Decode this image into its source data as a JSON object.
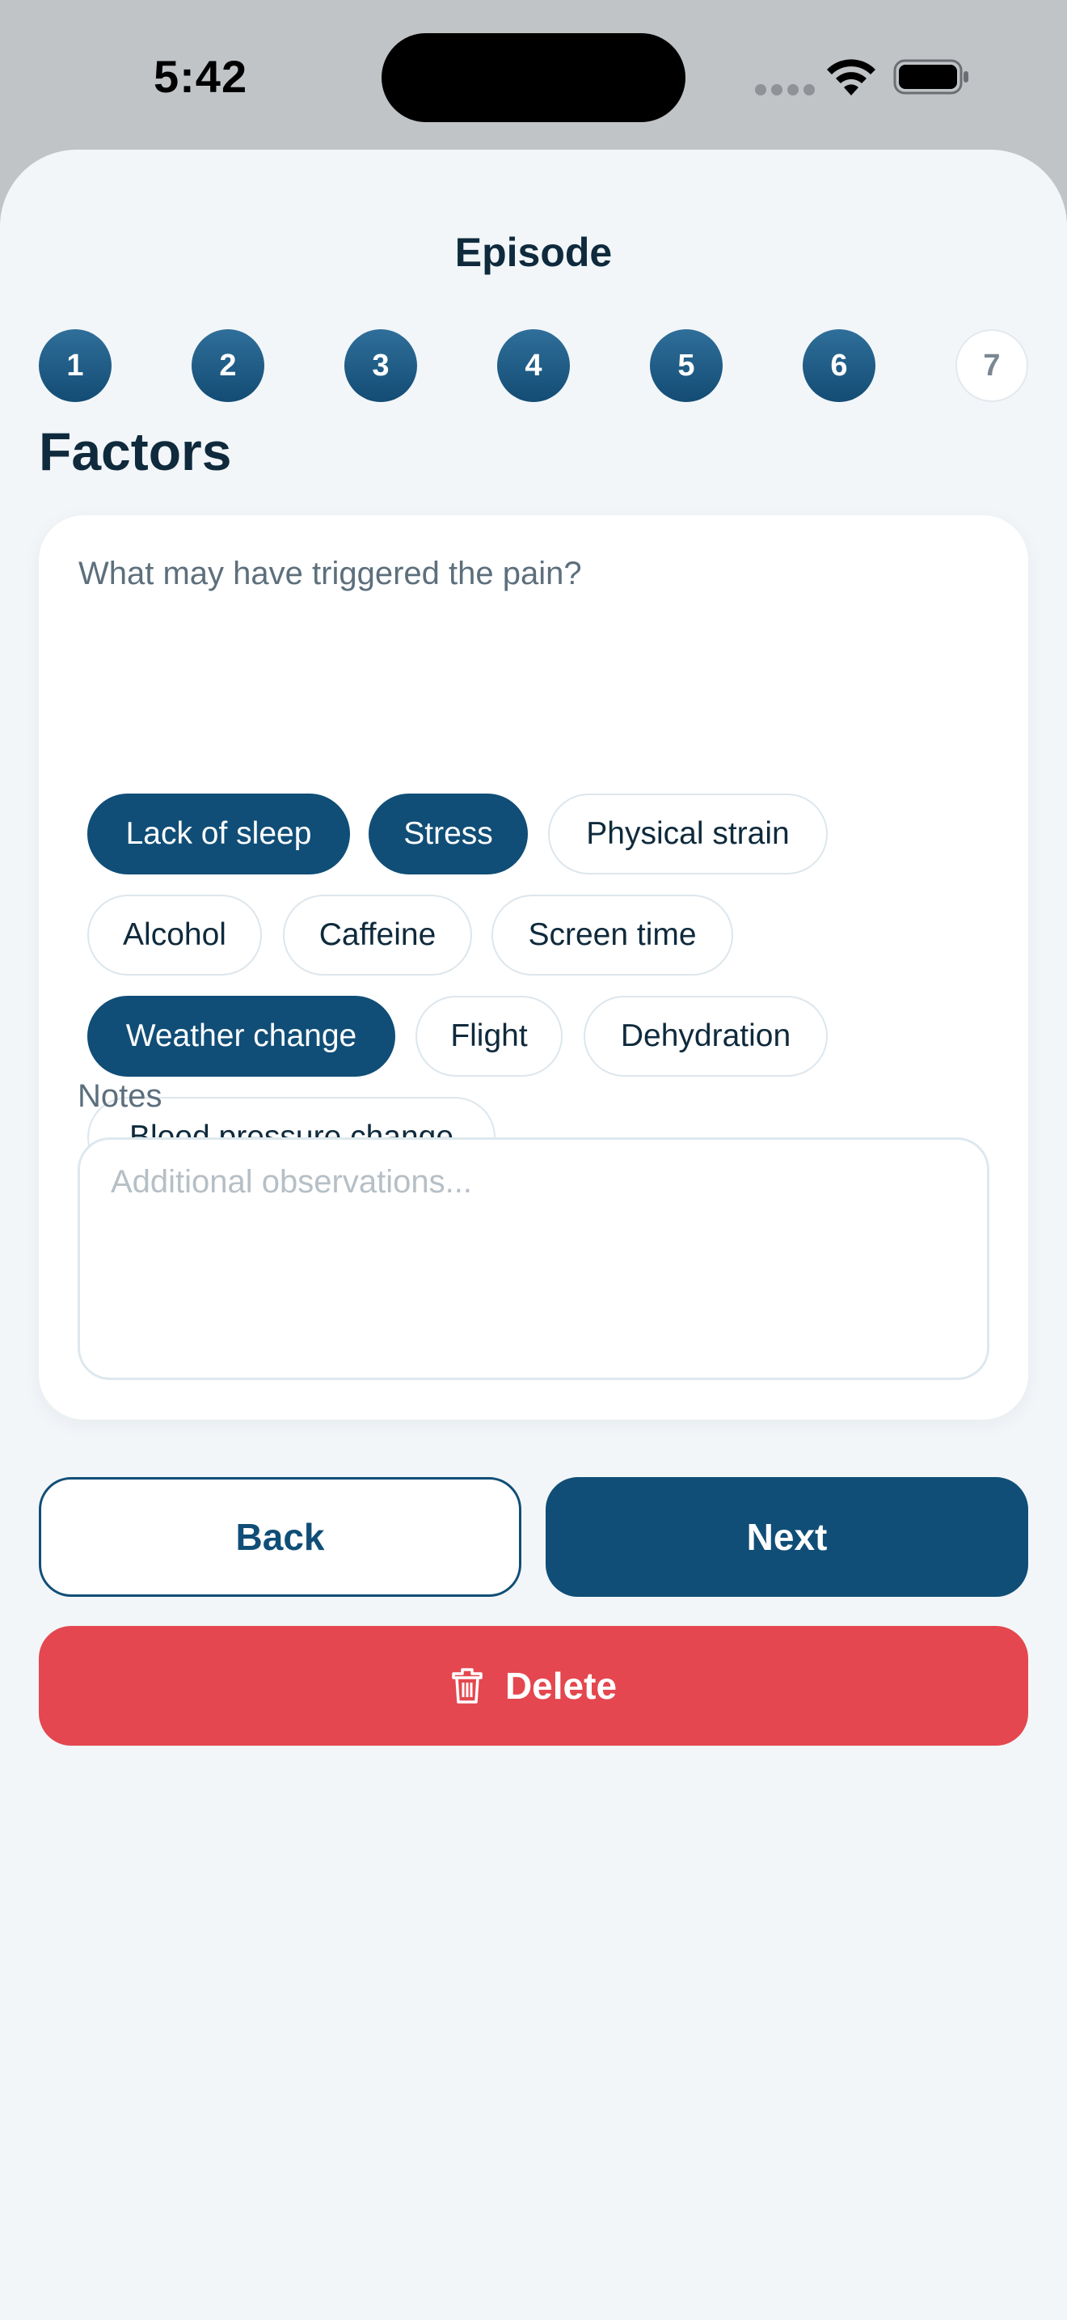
{
  "status_bar": {
    "time": "5:42"
  },
  "header": {
    "title": "Episode"
  },
  "stepper": {
    "current": 7,
    "steps": [
      "1",
      "2",
      "3",
      "4",
      "5",
      "6",
      "7"
    ]
  },
  "section": {
    "title": "Factors"
  },
  "triggers": {
    "question": "What may have triggered the pain?",
    "options": [
      {
        "label": "Lack of sleep",
        "selected": true
      },
      {
        "label": "Stress",
        "selected": true
      },
      {
        "label": "Physical strain",
        "selected": false
      },
      {
        "label": "Alcohol",
        "selected": false
      },
      {
        "label": "Caffeine",
        "selected": false
      },
      {
        "label": "Screen time",
        "selected": false
      },
      {
        "label": "Weather change",
        "selected": true
      },
      {
        "label": "Flight",
        "selected": false
      },
      {
        "label": "Dehydration",
        "selected": false
      },
      {
        "label": "Blood pressure change",
        "selected": false
      }
    ]
  },
  "notes": {
    "label": "Notes",
    "placeholder": "Additional observations...",
    "value": ""
  },
  "actions": {
    "back_label": "Back",
    "next_label": "Next",
    "delete_label": "Delete"
  },
  "colors": {
    "primary": "#104e77",
    "danger": "#e4474f",
    "background": "#f2f6f9"
  },
  "icons": {
    "wifi": "wifi-icon",
    "battery": "battery-icon",
    "delete": "trash-icon"
  }
}
